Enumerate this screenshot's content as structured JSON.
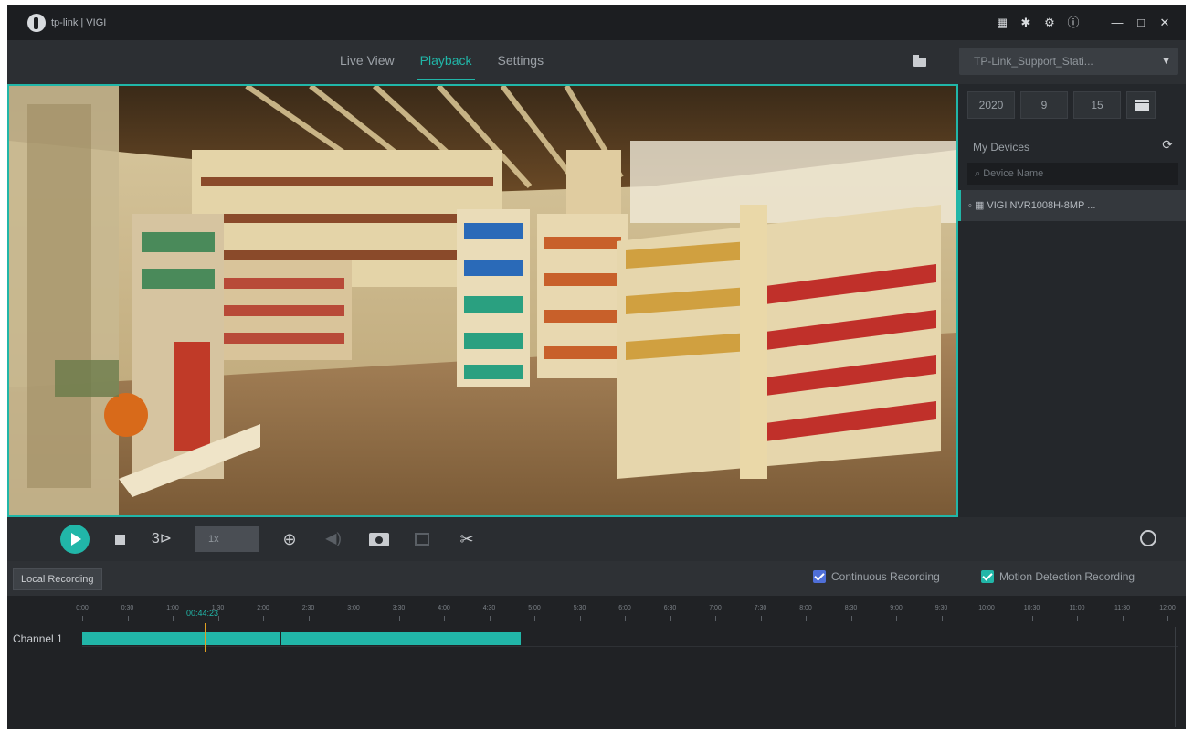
{
  "titlebar": {
    "app_title": "tp-link | VIGI",
    "icons": [
      "monitor-icon",
      "bug-icon",
      "gear-icon",
      "info-icon",
      "minimize-icon",
      "maximize-icon",
      "close-icon"
    ],
    "glyphs": [
      "▦",
      "✱",
      "⚙",
      "ⓘ",
      "—",
      "□",
      "✕"
    ]
  },
  "nav": {
    "tabs": [
      {
        "label": "Live View",
        "active": false
      },
      {
        "label": "Playback",
        "active": true
      },
      {
        "label": "Settings",
        "active": false
      }
    ],
    "site_select": "TP-Link_Support_Stati..."
  },
  "date": {
    "year": "2020",
    "month": "9",
    "day": "15"
  },
  "devices": {
    "title": "My Devices",
    "search_placeholder": "Device Name",
    "items": [
      "VIGI NVR1008H-8MP ..."
    ]
  },
  "controls": {
    "speed_label": "1x",
    "icons": [
      "play-icon",
      "stop-icon",
      "slow-forward-icon",
      "zoom-in-icon",
      "volume-icon",
      "snapshot-icon",
      "record-icon",
      "scissors-icon",
      "sync-icon"
    ]
  },
  "recording": {
    "local_button": "Local Recording",
    "options": [
      {
        "label": "Continuous Recording",
        "checked": true,
        "color": "#4f6fd8"
      },
      {
        "label": "Motion Detection Recording",
        "checked": true,
        "color": "#21b6a8"
      }
    ]
  },
  "timeline": {
    "cursor_time": "00:44:23",
    "channel_label": "Channel 1",
    "tick_labels": [
      "0:00",
      "0:30",
      "1:00",
      "1:30",
      "2:00",
      "2:30",
      "3:00",
      "3:30",
      "4:00",
      "4:30",
      "5:00",
      "5:30",
      "6:00",
      "6:30",
      "7:00",
      "7:30",
      "8:00",
      "8:30",
      "9:00",
      "9:30",
      "10:00",
      "10:30",
      "11:00",
      "11:30",
      "12:00"
    ]
  },
  "colors": {
    "accent": "#21b6a8",
    "cursor": "#e0a020"
  }
}
